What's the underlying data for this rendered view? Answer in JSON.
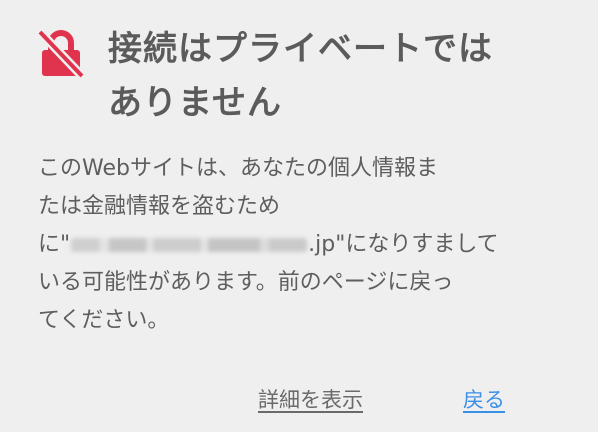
{
  "header": {
    "icon": "lock-broken-icon",
    "icon_color": "#e0344e",
    "title_line1": "接続はプライベートでは",
    "title_line2": "ありません"
  },
  "message": {
    "line1": "このWebサイトは、あなたの個人情報ま",
    "line2": "たは金融情報を盗むため",
    "line3_prefix": "に\"",
    "line3_suffix": ".jp\"になりすまして",
    "line4": "いる可能性があります。前のページに戻っ",
    "line5": "てください。"
  },
  "actions": {
    "details_label": "詳細を表示",
    "back_label": "戻る",
    "back_color": "#3a8fe6"
  }
}
